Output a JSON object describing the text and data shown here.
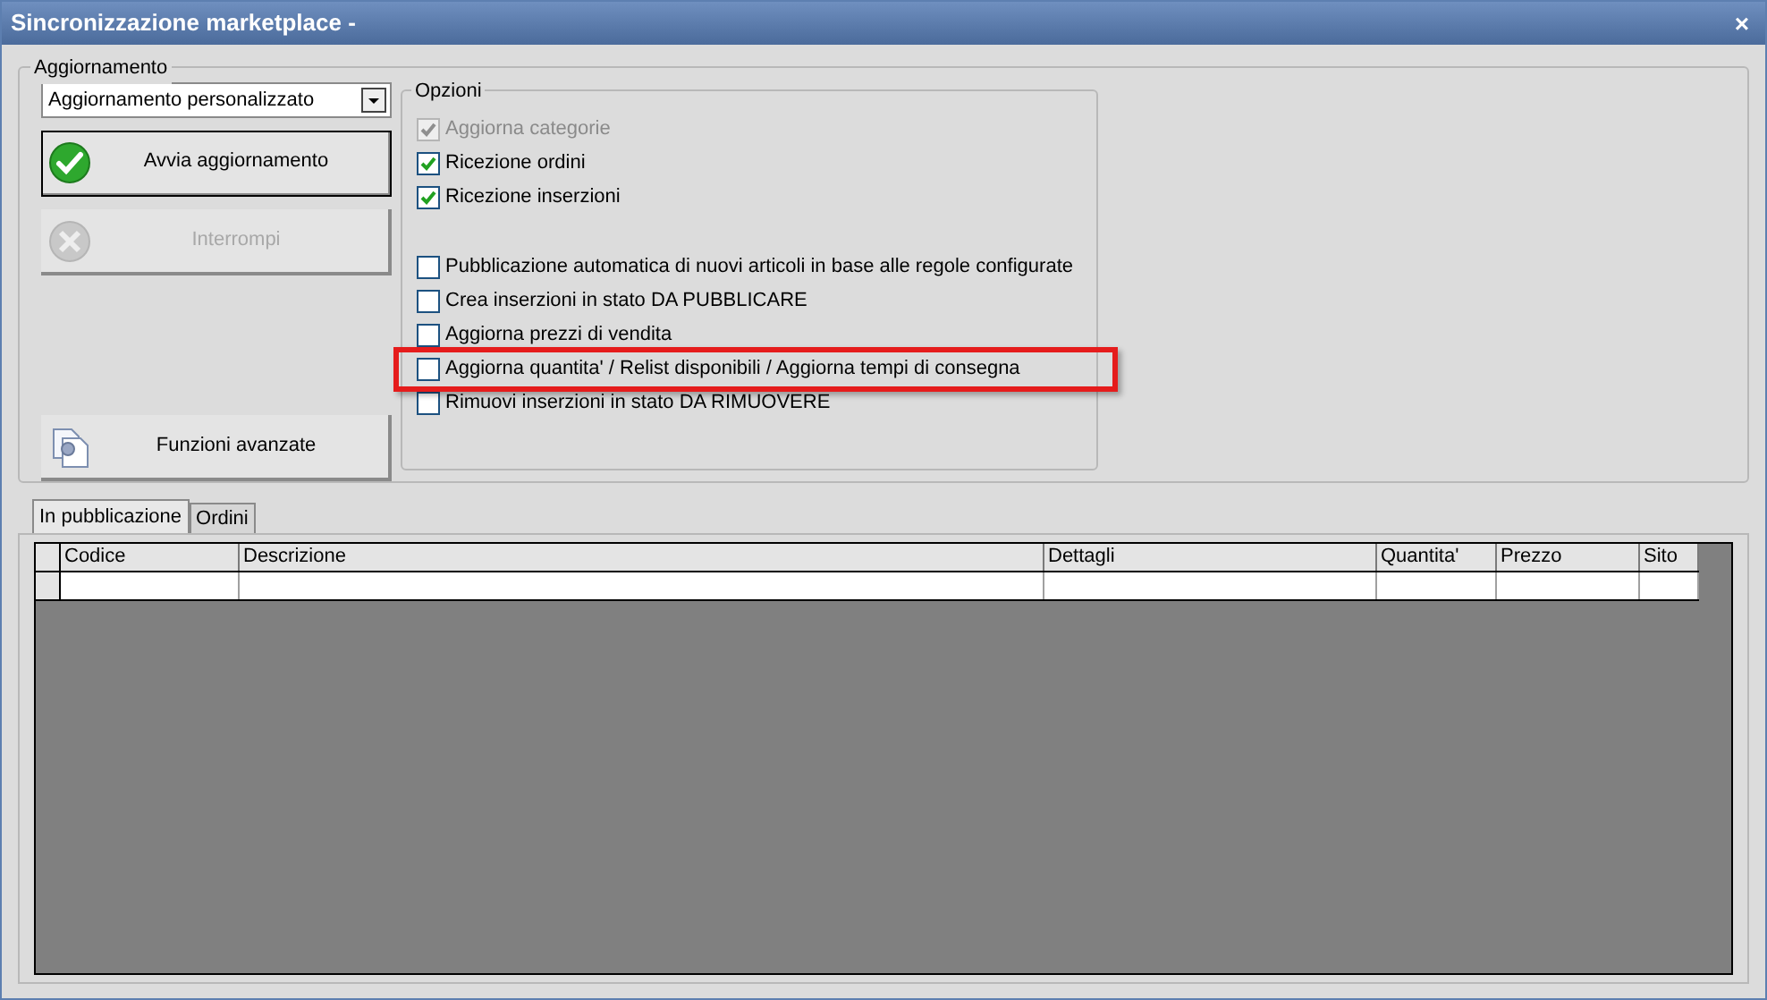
{
  "window": {
    "title": "Sincronizzazione marketplace -",
    "close": "×"
  },
  "update_group": {
    "title": "Aggiornamento",
    "mode": {
      "value": "Aggiornamento personalizzato"
    },
    "buttons": [
      {
        "kind": "start",
        "label": "Avvia aggiornamento",
        "disabled": false,
        "focused": true
      },
      {
        "kind": "stop",
        "label": "Interrompi",
        "disabled": true,
        "focused": false
      },
      {
        "kind": "advanced",
        "label": "Funzioni avanzate",
        "disabled": false,
        "focused": false
      }
    ]
  },
  "options_group": {
    "title": "Opzioni",
    "sections": [
      {
        "options": [
          {
            "label": "Aggiorna categorie",
            "checked": true,
            "disabled": true,
            "highlighted": false
          },
          {
            "label": "Ricezione ordini",
            "checked": true,
            "disabled": false,
            "highlighted": false
          },
          {
            "label": "Ricezione inserzioni",
            "checked": true,
            "disabled": false,
            "highlighted": false
          }
        ]
      },
      {
        "options": [
          {
            "label": "Pubblicazione automatica di nuovi articoli in base alle regole configurate",
            "checked": false,
            "disabled": false,
            "highlighted": false
          },
          {
            "label": "Crea inserzioni in stato DA PUBBLICARE",
            "checked": false,
            "disabled": false,
            "highlighted": false
          },
          {
            "label": "Aggiorna prezzi di vendita",
            "checked": false,
            "disabled": false,
            "highlighted": false
          },
          {
            "label": "Aggiorna quantita' / Relist disponibili / Aggiorna tempi di consegna",
            "checked": false,
            "disabled": false,
            "highlighted": true
          },
          {
            "label": "Rimuovi inserzioni in stato DA RIMUOVERE",
            "checked": false,
            "disabled": false,
            "highlighted": false
          }
        ]
      }
    ]
  },
  "tabs": [
    {
      "label": "In pubblicazione",
      "selected": true
    },
    {
      "label": "Ordini",
      "selected": false
    }
  ],
  "table": {
    "columns": [
      "Codice",
      "Descrizione",
      "Dettagli",
      "Quantita'",
      "Prezzo",
      "Sito"
    ]
  }
}
